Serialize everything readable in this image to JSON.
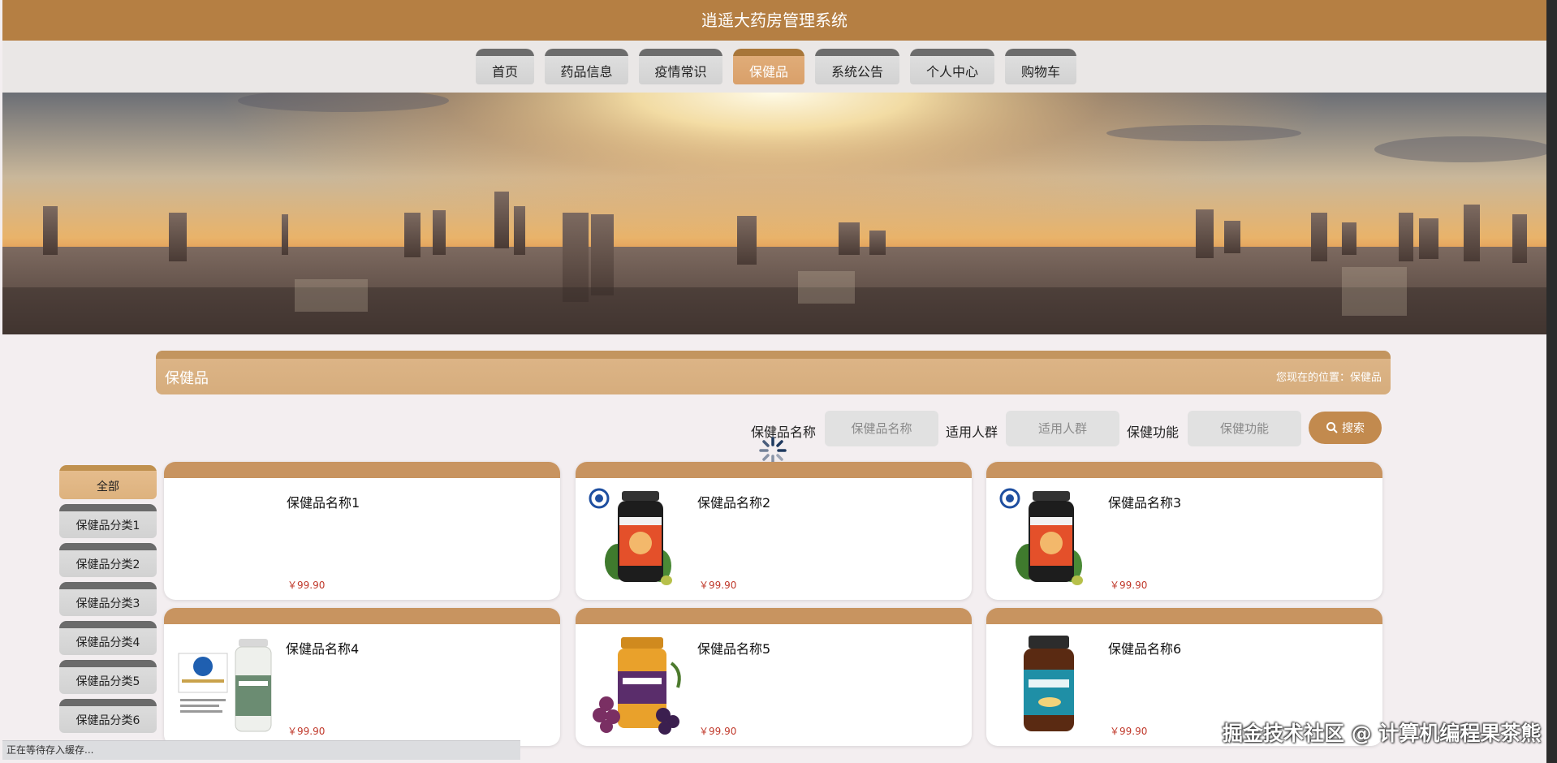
{
  "app_title": "逍遥大药房管理系统",
  "nav": {
    "items": [
      {
        "label": "首页",
        "active": false
      },
      {
        "label": "药品信息",
        "active": false
      },
      {
        "label": "疫情常识",
        "active": false
      },
      {
        "label": "保健品",
        "active": true
      },
      {
        "label": "系统公告",
        "active": false
      },
      {
        "label": "个人中心",
        "active": false
      },
      {
        "label": "购物车",
        "active": false
      }
    ]
  },
  "section": {
    "title": "保健品",
    "breadcrumb": "您现在的位置：保健品"
  },
  "search": {
    "fields": [
      {
        "label": "保健品名称",
        "placeholder": "保健品名称"
      },
      {
        "label": "适用人群",
        "placeholder": "适用人群"
      },
      {
        "label": "保健功能",
        "placeholder": "保健功能"
      }
    ],
    "button_label": "搜索"
  },
  "sidebar": {
    "items": [
      {
        "label": "全部",
        "active": true
      },
      {
        "label": "保健品分类1",
        "active": false
      },
      {
        "label": "保健品分类2",
        "active": false
      },
      {
        "label": "保健品分类3",
        "active": false
      },
      {
        "label": "保健品分类4",
        "active": false
      },
      {
        "label": "保健品分类5",
        "active": false
      },
      {
        "label": "保健品分类6",
        "active": false
      }
    ]
  },
  "products": [
    {
      "name": "保健品名称1",
      "price": "￥99.90",
      "image": "none"
    },
    {
      "name": "保健品名称2",
      "price": "￥99.90",
      "image": "maca-bottle"
    },
    {
      "name": "保健品名称3",
      "price": "￥99.90",
      "image": "maca-bottle"
    },
    {
      "name": "保健品名称4",
      "price": "￥99.90",
      "image": "health-certificate-bottle"
    },
    {
      "name": "保健品名称5",
      "price": "￥99.90",
      "image": "grape-seed-bottle"
    },
    {
      "name": "保健品名称6",
      "price": "￥99.90",
      "image": "omega3-bottle"
    }
  ],
  "status_text": "正在等待存入缓存...",
  "watermark": "掘金技术社区 @ 计算机编程果茶熊",
  "colors": {
    "brand": "#b57f43",
    "accent": "#c28a4e",
    "price": "#c0392b"
  }
}
